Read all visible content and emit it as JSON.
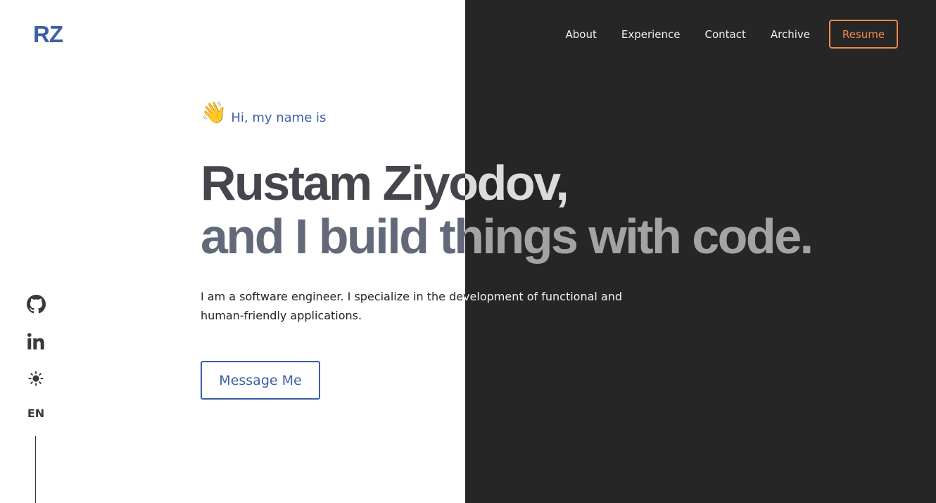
{
  "logo": "RZ",
  "nav": {
    "items": [
      {
        "label": "About"
      },
      {
        "label": "Experience"
      },
      {
        "label": "Contact"
      },
      {
        "label": "Archive"
      }
    ],
    "resume_label": "Resume"
  },
  "hero": {
    "wave_emoji": "👋",
    "greeting": "Hi, my name is",
    "name_line": "Rustam Ziyodov,",
    "tagline_line": "and I build things with code.",
    "intro_line1": "I am a software engineer. I specialize in the development of functional and",
    "intro_line2": "human-friendly applications.",
    "cta_label": "Message Me"
  },
  "social": {
    "icons": [
      "github-icon",
      "linkedin-icon",
      "sun-icon"
    ],
    "language": "EN"
  },
  "colors": {
    "accent_blue": "#3d5fa8",
    "accent_orange": "#f0894d",
    "dark_bg": "#262626",
    "light_bg": "#ffffff"
  }
}
